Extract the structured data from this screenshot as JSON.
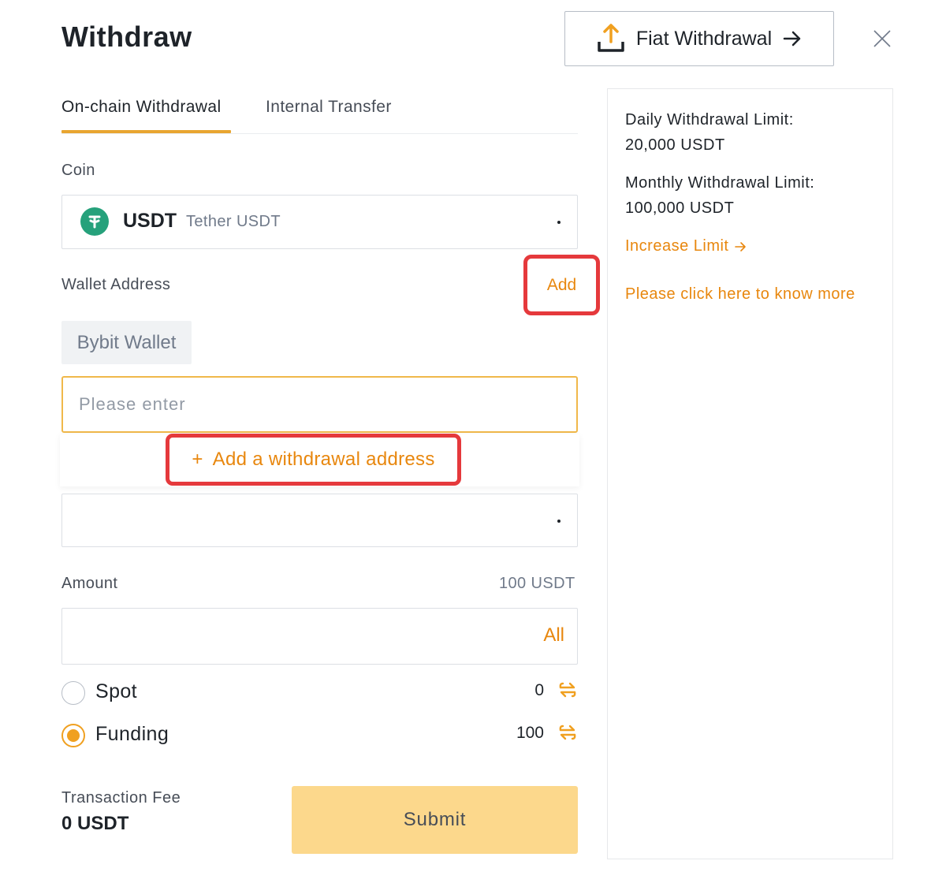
{
  "header": {
    "title": "Withdraw",
    "fiat_button": "Fiat Withdrawal"
  },
  "tabs": [
    {
      "label": "On-chain Withdrawal",
      "active": true
    },
    {
      "label": "Internal Transfer",
      "active": false
    }
  ],
  "coin": {
    "label": "Coin",
    "ticker": "USDT",
    "name": "Tether USDT",
    "icon": "tether-icon",
    "icon_color": "#26a17b"
  },
  "wallet": {
    "label": "Wallet Address",
    "add_label": "Add",
    "chip": "Bybit Wallet",
    "placeholder": "Please enter",
    "value": "",
    "add_address_label": "Add a withdrawal address",
    "add_address_prefix": "+"
  },
  "amount": {
    "label": "Amount",
    "limit": "100 USDT",
    "value": "",
    "all_label": "All"
  },
  "accounts": [
    {
      "label": "Spot",
      "balance": "0",
      "selected": false
    },
    {
      "label": "Funding",
      "balance": "100",
      "selected": true
    }
  ],
  "fee": {
    "label": "Transaction Fee",
    "value": "0 USDT"
  },
  "submit_label": "Submit",
  "side": {
    "daily_label": "Daily Withdrawal Limit:",
    "daily_value": "20,000 USDT",
    "monthly_label": "Monthly Withdrawal Limit:",
    "monthly_value": "100,000 USDT",
    "increase_label": "Increase Limit",
    "more_link": "Please click here to know more"
  },
  "colors": {
    "accent": "#e8870e",
    "highlight": "#e5393c",
    "submit_bg": "#fcd88c"
  }
}
